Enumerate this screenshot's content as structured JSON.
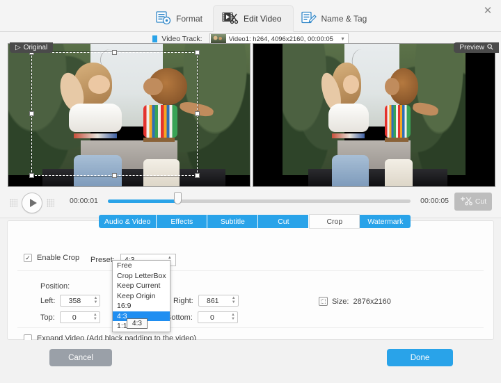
{
  "window": {
    "close_label": "✕"
  },
  "tabs": [
    {
      "label": "Format",
      "icon": "format-icon",
      "active": false
    },
    {
      "label": "Edit Video",
      "icon": "edit-video-icon",
      "active": true
    },
    {
      "label": "Name & Tag",
      "icon": "name-tag-icon",
      "active": false
    }
  ],
  "video_track": {
    "label": "Video Track:",
    "selected": "Video1: h264, 4096x2160, 00:00:05"
  },
  "preview": {
    "original_badge": "Original",
    "preview_badge": "Preview"
  },
  "transport": {
    "current_time": "00:00:01",
    "total_time": "00:00:05",
    "cut_label": "Cut",
    "progress_percent": 23
  },
  "subtabs": [
    {
      "label": "Audio & Video",
      "active": false
    },
    {
      "label": "Effects",
      "active": false
    },
    {
      "label": "Subtitle",
      "active": false
    },
    {
      "label": "Cut",
      "active": false
    },
    {
      "label": "Crop",
      "active": true
    },
    {
      "label": "Watermark",
      "active": false
    }
  ],
  "crop": {
    "enable_label": "Enable Crop",
    "enable_checked": true,
    "check_glyph": "✓",
    "preset_label": "Preset:",
    "preset_value": "4:3",
    "preset_options": [
      "Free",
      "Crop LetterBox",
      "Keep Current",
      "Keep Origin",
      "16:9",
      "4:3",
      "1:1"
    ],
    "preset_selected_index": 5,
    "tooltip_text": "4:3",
    "position_label": "Position:",
    "left_label": "Left:",
    "left_value": "358",
    "right_label": "Right:",
    "right_value": "861",
    "top_label": "Top:",
    "top_value": "0",
    "bottom_label": "Bottom:",
    "bottom_value": "0",
    "size_label": "Size:",
    "size_value": "2876x2160",
    "expand_label": "Expand Video (Add black padding to the video)",
    "expand_checked": false
  },
  "footer": {
    "cancel_label": "Cancel",
    "done_label": "Done"
  },
  "colors": {
    "accent": "#29a3e9",
    "highlight": "#1f8ef1",
    "cancel": "#9aa0a8"
  }
}
